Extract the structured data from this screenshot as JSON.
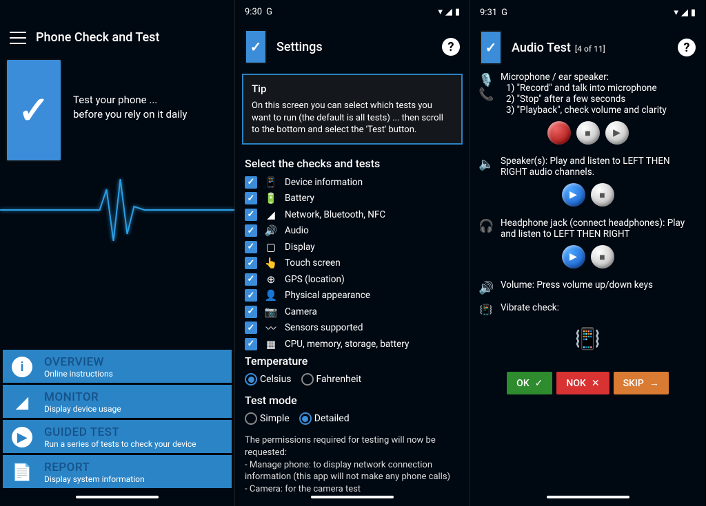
{
  "panel1": {
    "appTitle": "Phone Check and Test",
    "heroLine1": "Test your phone ...",
    "heroLine2": "before you rely on it daily",
    "menu": [
      {
        "title": "OVERVIEW",
        "sub": "Online instructions"
      },
      {
        "title": "MONITOR",
        "sub": "Display device usage"
      },
      {
        "title": "GUIDED TEST",
        "sub": "Run a series of tests to check your device"
      },
      {
        "title": "REPORT",
        "sub": "Display system information"
      }
    ]
  },
  "panel2": {
    "time": "9:30",
    "title": "Settings",
    "tipHeading": "Tip",
    "tipBody": "On this screen you can select which tests you want to run (the default is all tests) ... then scroll to the bottom and select the 'Test' button.",
    "selectHeading": "Select the checks and tests",
    "checks": [
      "Device information",
      "Battery",
      "Network, Bluetooth, NFC",
      "Audio",
      "Display",
      "Touch screen",
      "GPS (location)",
      "Physical appearance",
      "Camera",
      "Sensors supported",
      "CPU, memory, storage, battery"
    ],
    "checkIcons": [
      "📱",
      "🔋",
      "◢",
      "🔊",
      "▢",
      "👆",
      "⊕",
      "👤",
      "📷",
      "〰",
      "▦"
    ],
    "tempHeading": "Temperature",
    "tempOpts": [
      "Celsius",
      "Fahrenheit"
    ],
    "modeHeading": "Test mode",
    "modeOpts": [
      "Simple",
      "Detailed"
    ],
    "perm": "The permissions required for testing will now be requested:\n- Manage phone: to display network connection information (this app will not make any phone calls)\n- Camera: for the camera test"
  },
  "panel3": {
    "time": "9:31",
    "title": "Audio Test",
    "position": "[4 of 11]",
    "micHead": "Microphone / ear speaker:",
    "mic1": "1) \"Record\" and talk into microphone",
    "mic2": "2) \"Stop\" after a few  seconds",
    "mic3": "3) \"Playback\", check volume and clarity",
    "speaker": "Speaker(s): Play and listen to LEFT THEN RIGHT audio channels.",
    "headphone": "Headphone jack (connect headphones): Play and listen to LEFT THEN RIGHT",
    "volume": "Volume: Press volume up/down keys",
    "vibrate": "Vibrate check:",
    "ok": "OK",
    "nok": "NOK",
    "skip": "SKIP"
  }
}
